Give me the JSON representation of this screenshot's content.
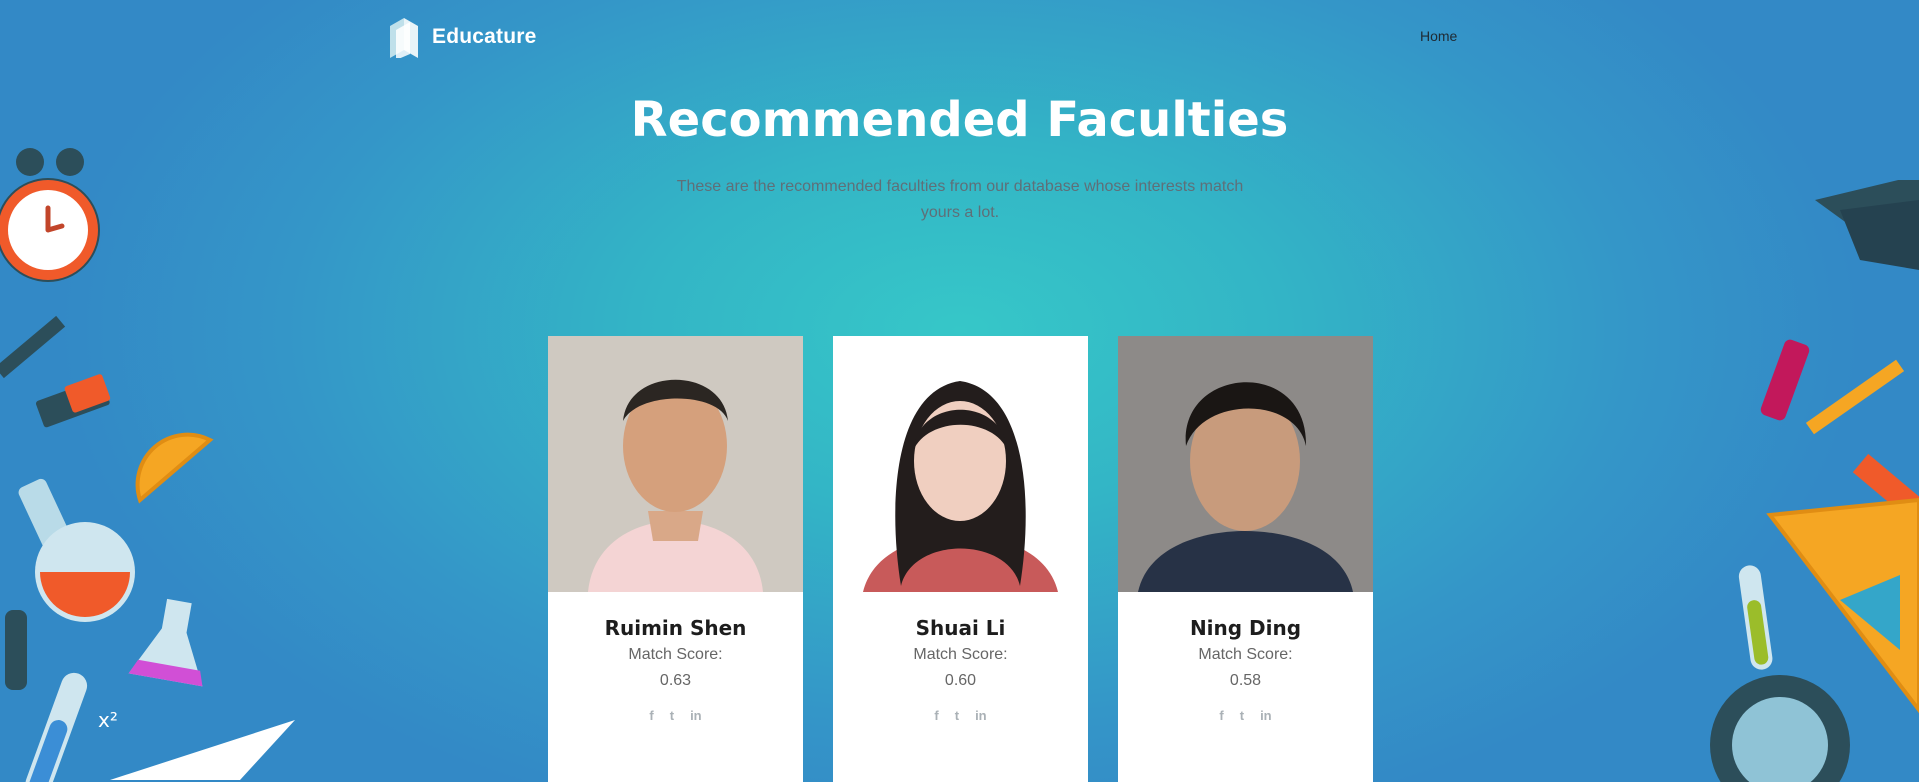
{
  "brand": {
    "name": "Educature"
  },
  "nav": {
    "home": "Home"
  },
  "hero": {
    "title": "Recommended Faculties",
    "subtitle": "These are the recommended faculties from our database whose interests match yours a lot."
  },
  "faculties": [
    {
      "name": "Ruimin Shen",
      "score_label": "Match Score:",
      "score": "0.63"
    },
    {
      "name": "Shuai Li",
      "score_label": "Match Score:",
      "score": "0.60"
    },
    {
      "name": "Ning Ding",
      "score_label": "Match Score:",
      "score": "0.58"
    }
  ],
  "social_icons": [
    "facebook-icon",
    "twitter-icon",
    "linkedin-icon"
  ],
  "colors": {
    "accent": "#36c7c8",
    "background": "#3496c8"
  }
}
